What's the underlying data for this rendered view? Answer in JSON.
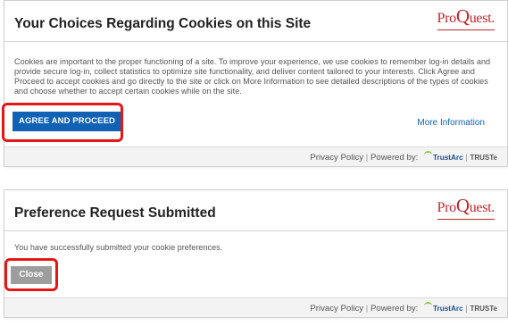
{
  "consent_dialog": {
    "title": "Your Choices Regarding Cookies on this Site",
    "logo_text_prefix": "Pro",
    "logo_text_big": "Q",
    "logo_text_suffix": "uest",
    "logo_text_dot": ".",
    "body": "Cookies are important to the proper functioning of a site. To improve your experience, we use cookies to remember log-in details and provide secure log-in, collect statistics to optimize site functionality, and deliver content tailored to your interests. Click Agree and Proceed to accept cookies and go directly to the site or click on More Information to see detailed descriptions of the types of cookies and choose whether to accept certain cookies while on the site.",
    "agree_button_label": "AGREE AND PROCEED",
    "more_information_label": "More Information",
    "footer": {
      "privacy_policy": "Privacy Policy",
      "separator": "|",
      "powered_by": "Powered by:",
      "trustarc": "TrustArc",
      "separator2": "|",
      "truste": "TRUSTe"
    }
  },
  "submitted_dialog": {
    "title": "Preference Request Submitted",
    "logo_text_prefix": "Pro",
    "logo_text_big": "Q",
    "logo_text_suffix": "uest",
    "logo_text_dot": ".",
    "body": "You have successfully submitted your cookie preferences.",
    "close_button_label": "Close",
    "footer": {
      "privacy_policy": "Privacy Policy",
      "separator": "|",
      "powered_by": "Powered by:",
      "trustarc": "TrustArc",
      "separator2": "|",
      "truste": "TRUSTe"
    }
  },
  "colors": {
    "primary_button": "#0f62b4",
    "link": "#0f62b4",
    "close_button": "#9d9d9d",
    "highlight": "#e51616",
    "logo": "#c0272d",
    "footer_bg": "#f3f3f3"
  },
  "icons": {
    "trustarc_logo": "trustarc-logo-icon",
    "proquest_logo": "proquest-logo"
  }
}
